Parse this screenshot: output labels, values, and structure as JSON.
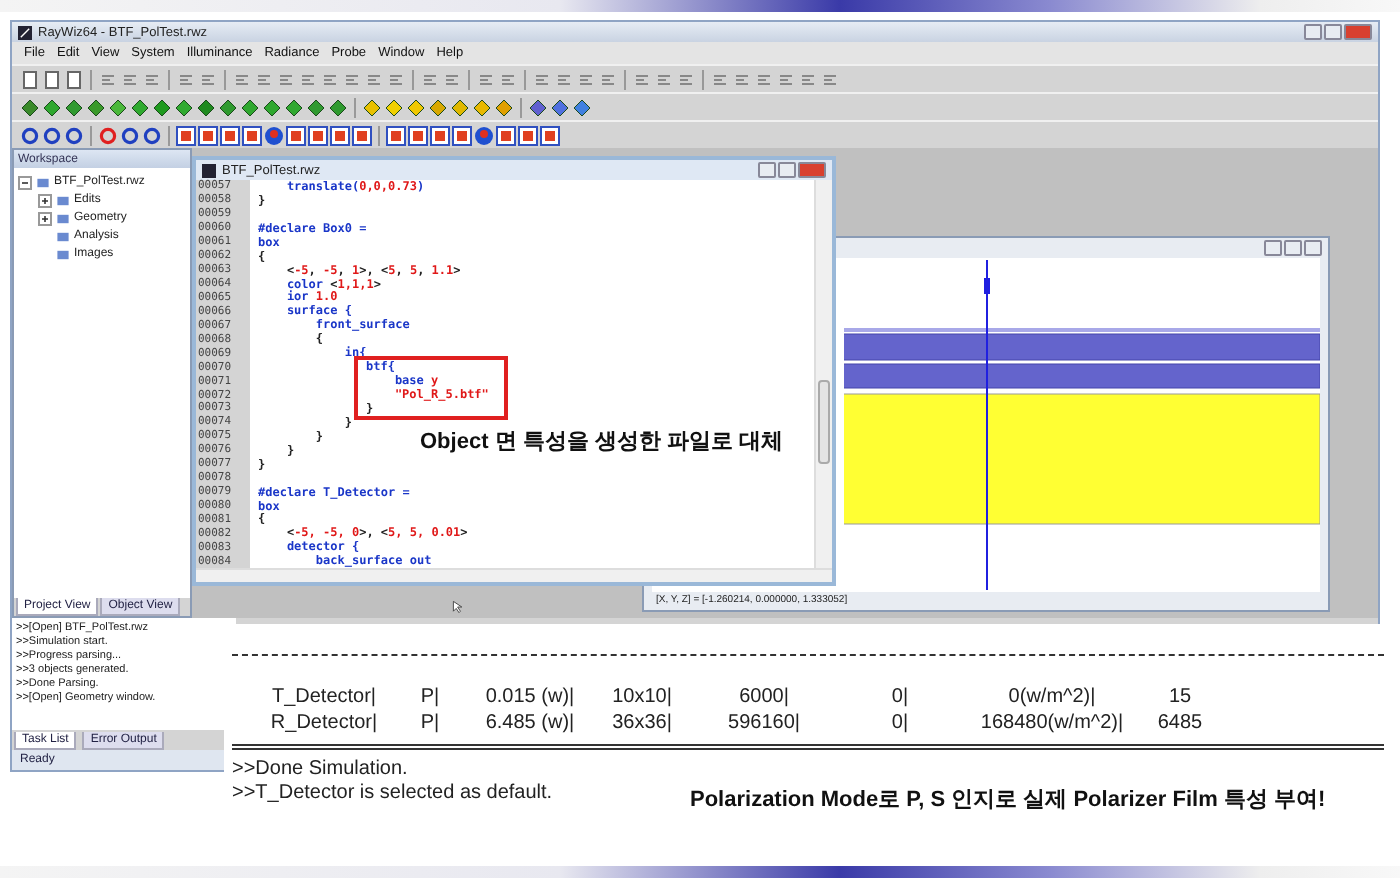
{
  "window": {
    "title": "RayWiz64 - BTF_PolTest.rwz"
  },
  "menu": [
    "File",
    "Edit",
    "View",
    "System",
    "Illuminance",
    "Radiance",
    "Probe",
    "Window",
    "Help"
  ],
  "workspace": {
    "title": "Workspace",
    "tree": [
      {
        "label": "BTF_PolTest.rwz",
        "expanded": true,
        "children": [
          {
            "label": "Edits",
            "expanded": false
          },
          {
            "label": "Geometry",
            "expanded": false
          },
          {
            "label": "Analysis"
          },
          {
            "label": "Images"
          }
        ]
      }
    ],
    "tabs": [
      {
        "label": "Project View",
        "selected": true
      },
      {
        "label": "Object View",
        "selected": false
      }
    ]
  },
  "editor": {
    "title": "BTF_PolTest.rwz",
    "blocks": [
      {
        "boxed": false,
        "lines": [
          {
            "number": "00057",
            "tokens": [
              {
                "t": "    translate(",
                "kind": "kw"
              },
              {
                "t": "0,0,0.73",
                "kind": "num"
              },
              {
                "t": ")",
                "kind": "kw"
              }
            ]
          },
          {
            "number": "00058",
            "tokens": [
              {
                "t": "}",
                "kind": "plain"
              }
            ]
          },
          {
            "number": "00059"
          },
          {
            "number": "00060",
            "tokens": [
              {
                "t": "#declare Box0 =",
                "kind": "kw"
              }
            ]
          },
          {
            "number": "00061",
            "tokens": [
              {
                "t": "box",
                "kind": "kw"
              }
            ]
          },
          {
            "number": "00062",
            "tokens": [
              {
                "t": "{",
                "kind": "plain"
              }
            ]
          },
          {
            "number": "00063",
            "tokens": [
              {
                "t": "    <",
                "kind": "plain"
              },
              {
                "t": "-5",
                "kind": "num"
              },
              {
                "t": ", ",
                "kind": "plain"
              },
              {
                "t": "-5",
                "kind": "num"
              },
              {
                "t": ", ",
                "kind": "plain"
              },
              {
                "t": "1",
                "kind": "num"
              },
              {
                "t": ">, <",
                "kind": "plain"
              },
              {
                "t": "5",
                "kind": "num"
              },
              {
                "t": ", ",
                "kind": "plain"
              },
              {
                "t": "5",
                "kind": "num"
              },
              {
                "t": ", ",
                "kind": "plain"
              },
              {
                "t": "1.1",
                "kind": "num"
              },
              {
                "t": ">",
                "kind": "plain"
              }
            ]
          },
          {
            "number": "00064",
            "tokens": [
              {
                "t": "    color ",
                "kind": "kw"
              },
              {
                "t": "<",
                "kind": "plain"
              },
              {
                "t": "1,1,1",
                "kind": "num"
              },
              {
                "t": ">",
                "kind": "plain"
              }
            ]
          },
          {
            "number": "00065",
            "tokens": [
              {
                "t": "    ior ",
                "kind": "kw"
              },
              {
                "t": "1.0",
                "kind": "num"
              }
            ]
          },
          {
            "number": "00066",
            "tokens": [
              {
                "t": "    surface {",
                "kind": "kw"
              }
            ]
          },
          {
            "number": "00067",
            "tokens": [
              {
                "t": "        front_surface",
                "kind": "kw"
              }
            ]
          },
          {
            "number": "00068",
            "tokens": [
              {
                "t": "        {",
                "kind": "plain"
              }
            ]
          },
          {
            "number": "00069",
            "tokens": [
              {
                "t": "            in{",
                "kind": "kw"
              }
            ]
          }
        ]
      },
      {
        "boxed": true,
        "lines": [
          {
            "number": "00070",
            "tokens": [
              {
                "t": "btf{",
                "kind": "kw"
              }
            ]
          },
          {
            "number": "00071",
            "tokens": [
              {
                "t": "    base ",
                "kind": "kw"
              },
              {
                "t": "y",
                "kind": "num"
              }
            ]
          },
          {
            "number": "00072",
            "tokens": [
              {
                "t": "    \"Pol_R_5.btf\"",
                "kind": "num"
              }
            ]
          },
          {
            "number": "00073",
            "tokens": [
              {
                "t": "}",
                "kind": "plain"
              }
            ]
          }
        ]
      },
      {
        "boxed": false,
        "lines": [
          {
            "number": "00074",
            "tokens": [
              {
                "t": "            }",
                "kind": "plain"
              }
            ]
          },
          {
            "number": "00075",
            "tokens": [
              {
                "t": "        }",
                "kind": "plain"
              }
            ]
          },
          {
            "number": "00076",
            "tokens": [
              {
                "t": "    }",
                "kind": "plain"
              }
            ]
          },
          {
            "number": "00077",
            "tokens": [
              {
                "t": "}",
                "kind": "plain"
              }
            ]
          },
          {
            "number": "00078"
          },
          {
            "number": "00079",
            "tokens": [
              {
                "t": "#declare T_Detector =",
                "kind": "kw"
              }
            ]
          },
          {
            "number": "00080",
            "tokens": [
              {
                "t": "box",
                "kind": "kw"
              }
            ]
          },
          {
            "number": "00081",
            "tokens": [
              {
                "t": "{",
                "kind": "plain"
              }
            ]
          },
          {
            "number": "00082",
            "tokens": [
              {
                "t": "    <",
                "kind": "plain"
              },
              {
                "t": "-5, -5, 0",
                "kind": "num"
              },
              {
                "t": ">, <",
                "kind": "plain"
              },
              {
                "t": "5, 5, 0.01",
                "kind": "num"
              },
              {
                "t": ">",
                "kind": "plain"
              }
            ]
          },
          {
            "number": "00083",
            "tokens": [
              {
                "t": "    detector {",
                "kind": "kw"
              }
            ]
          },
          {
            "number": "00084",
            "tokens": [
              {
                "t": "        back_surface out",
                "kind": "kw"
              }
            ]
          }
        ]
      }
    ]
  },
  "view3d": {
    "coordinates": "[X, Y, Z] = [-1.260214, 0.000000, 1.333052]"
  },
  "log": {
    "lines": [
      ">>[Open] BTF_PolTest.rwz",
      ">>Simulation start.",
      ">>Progress parsing...",
      ">>3 objects generated.",
      ">>Done Parsing.",
      ">>[Open] Geometry window."
    ],
    "tabs": [
      {
        "label": "Task List",
        "selected": true
      },
      {
        "label": "Error Output",
        "selected": false
      }
    ]
  },
  "status_bar": "Ready",
  "output": {
    "rows": [
      [
        "T_Detector|",
        "P|",
        "0.015 (w)|",
        "10x10|",
        "6000|",
        "0|",
        "0(w/m^2)|",
        "15"
      ],
      [
        "R_Detector|",
        "P|",
        "6.485 (w)|",
        "36x36|",
        "596160|",
        "0|",
        "168480(w/m^2)|",
        "6485"
      ]
    ],
    "messages": [
      ">>Done Simulation.",
      ">>T_Detector is selected as default."
    ]
  },
  "annotations": [
    {
      "kind": "editor",
      "text": "Object 면 특성을 생성한 파일로 대체"
    },
    {
      "kind": "output",
      "text": "Polarization Mode로 P, S 인지로 실제 Polarizer Film 특성 부여!"
    }
  ]
}
